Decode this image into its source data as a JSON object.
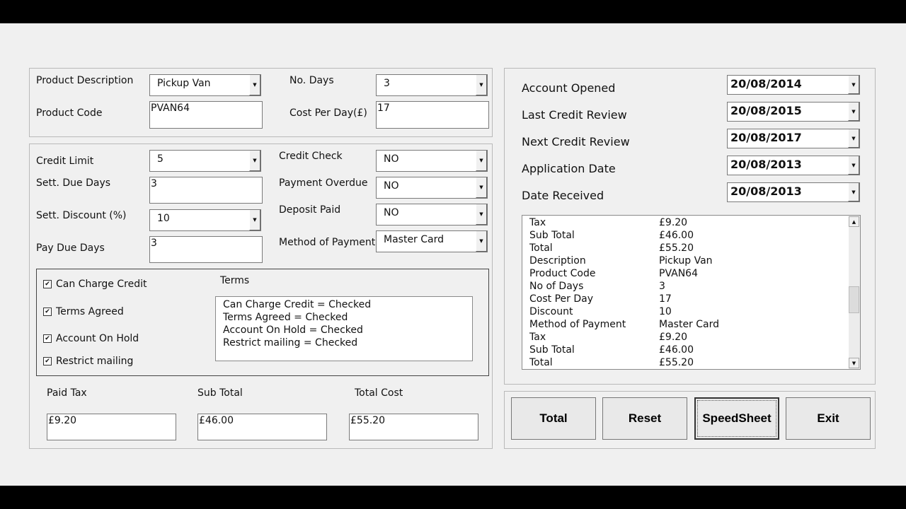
{
  "product": {
    "description_label": "Product Description",
    "description_value": "Pickup Van",
    "code_label": "Product Code",
    "code_value": "PVAN64",
    "days_label": "No. Days",
    "days_value": "3",
    "cost_label": "Cost Per Day(£)",
    "cost_value": "17"
  },
  "credit": {
    "limit_label": "Credit Limit",
    "limit_value": "5",
    "sett_due_label": "Sett. Due Days",
    "sett_due_value": "3",
    "sett_discount_label": "Sett. Discount (%)",
    "sett_discount_value": "10",
    "pay_due_label": "Pay Due Days",
    "pay_due_value": "3",
    "check_label": "Credit Check",
    "check_value": "NO",
    "overdue_label": "Payment Overdue",
    "overdue_value": "NO",
    "deposit_label": "Deposit Paid",
    "deposit_value": "NO",
    "method_label": "Method of Payment",
    "method_value": "Master Card"
  },
  "checkboxes": [
    {
      "label": "Can Charge Credit",
      "checked": true
    },
    {
      "label": "Terms Agreed",
      "checked": true
    },
    {
      "label": "Account On Hold",
      "checked": true
    },
    {
      "label": "Restrict mailing",
      "checked": true
    }
  ],
  "terms": {
    "label": "Terms",
    "lines": [
      "Can Charge Credit = Checked",
      "Terms Agreed = Checked",
      "Account On Hold = Checked",
      "Restrict mailing = Checked"
    ]
  },
  "totals": {
    "tax_label": "Paid Tax",
    "tax_value": "£9.20",
    "sub_label": "Sub Total",
    "sub_value": "£46.00",
    "total_label": "Total Cost",
    "total_value": "£55.20"
  },
  "dates": [
    {
      "label": "Account Opened",
      "value": "20/08/2014"
    },
    {
      "label": "Last Credit Review",
      "value": "20/08/2015"
    },
    {
      "label": "Next Credit Review",
      "value": "20/08/2017"
    },
    {
      "label": "Application Date",
      "value": "20/08/2013"
    },
    {
      "label": "Date Received",
      "value": "20/08/2013"
    }
  ],
  "receipt": [
    [
      "Tax",
      "£9.20"
    ],
    [
      "Sub Total",
      "£46.00"
    ],
    [
      "Total",
      "£55.20"
    ],
    [
      "Description",
      "Pickup Van"
    ],
    [
      "Product Code",
      "PVAN64"
    ],
    [
      "No of Days",
      "3"
    ],
    [
      "Cost Per Day",
      "17"
    ],
    [
      "Discount",
      "10"
    ],
    [
      "Method of Payment",
      "Master Card"
    ],
    [
      "Tax",
      "£9.20"
    ],
    [
      "Sub Total",
      "£46.00"
    ],
    [
      "Total",
      "£55.20"
    ]
  ],
  "buttons": {
    "total": "Total",
    "reset": "Reset",
    "speedsheet": "SpeedSheet",
    "exit": "Exit"
  },
  "icons": {
    "dropdown": "triangle-down",
    "scroll_up": "triangle-up",
    "scroll_down": "triangle-down",
    "check": "checkmark"
  }
}
